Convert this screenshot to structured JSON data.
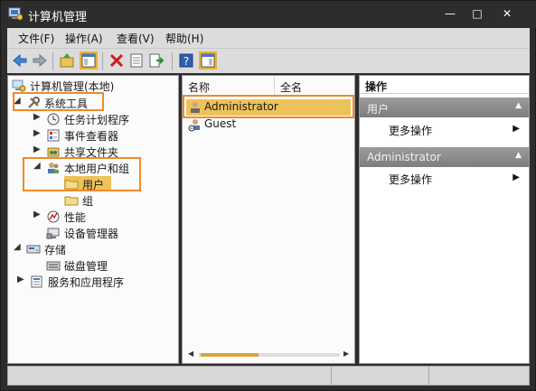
{
  "window": {
    "title": "计算机管理",
    "controls": {
      "minimize": "—",
      "maximize": "□",
      "close": "✕"
    }
  },
  "menu": [
    "文件(F)",
    "操作(A)",
    "查看(V)",
    "帮助(H)"
  ],
  "toolbar": {
    "icons": [
      "back-arrow-icon",
      "forward-arrow-icon",
      "up-folder-icon",
      "show-hide-tree-icon",
      "delete-icon",
      "properties-icon",
      "export-list-icon",
      "help-icon",
      "action-pane-icon"
    ]
  },
  "tree": {
    "root": "计算机管理(本地)",
    "system_tools": "系统工具",
    "task_scheduler": "任务计划程序",
    "event_viewer": "事件查看器",
    "shared_folders": "共享文件夹",
    "local_users_groups": "本地用户和组",
    "users": "用户",
    "groups": "组",
    "performance": "性能",
    "device_manager": "设备管理器",
    "storage": "存储",
    "disk_management": "磁盘管理",
    "services_apps": "服务和应用程序"
  },
  "list": {
    "columns": [
      "名称",
      "全名"
    ],
    "rows": [
      {
        "name": "Administrator",
        "selected": true
      },
      {
        "name": "Guest",
        "selected": false
      }
    ]
  },
  "actions": {
    "title": "操作",
    "sections": [
      {
        "header": "用户",
        "items": [
          "更多操作"
        ]
      },
      {
        "header": "Administrator",
        "items": [
          "更多操作"
        ]
      }
    ]
  },
  "colors": {
    "highlight_border": "#ef8a2a",
    "selection": "#eec25b",
    "titlebar": "#2d2d2d"
  }
}
